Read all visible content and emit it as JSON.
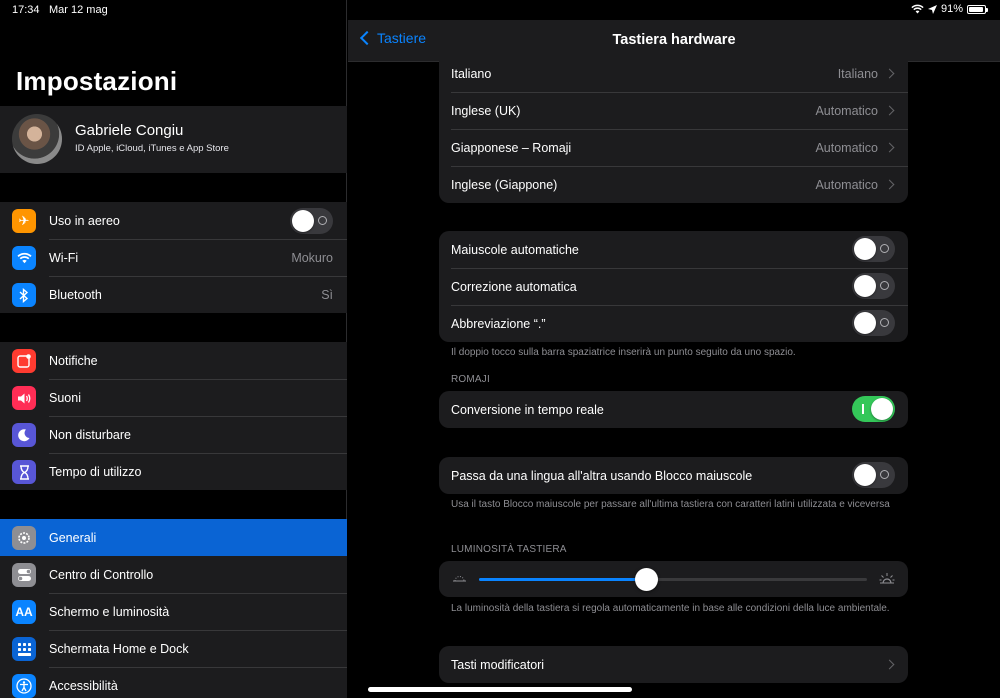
{
  "status": {
    "time": "17:34",
    "date": "Mar 12 mag",
    "battery": "91%",
    "battery_level": 0.91
  },
  "sidebar": {
    "title": "Impostazioni",
    "profile": {
      "name": "Gabriele Congiu",
      "subtitle": "ID Apple, iCloud, iTunes e App Store"
    },
    "groups": [
      [
        {
          "label": "Uso in aereo",
          "icon": "airplane-icon",
          "color": "#ff9500",
          "toggle": false
        },
        {
          "label": "Wi-Fi",
          "icon": "wifi-icon",
          "color": "#0a84ff",
          "value": "Mokuro"
        },
        {
          "label": "Bluetooth",
          "icon": "bluetooth-icon",
          "color": "#0a84ff",
          "value": "Sì"
        }
      ],
      [
        {
          "label": "Notifiche",
          "icon": "notifications-icon",
          "color": "#ff3b30"
        },
        {
          "label": "Suoni",
          "icon": "speaker-icon",
          "color": "#ff2d55"
        },
        {
          "label": "Non disturbare",
          "icon": "moon-icon",
          "color": "#5856d6"
        },
        {
          "label": "Tempo di utilizzo",
          "icon": "hourglass-icon",
          "color": "#5856d6"
        }
      ],
      [
        {
          "label": "Generali",
          "icon": "gear-icon",
          "color": "#8e8e93",
          "selected": true
        },
        {
          "label": "Centro di Controllo",
          "icon": "switches-icon",
          "color": "#8e8e93"
        },
        {
          "label": "Schermo e luminosità",
          "icon": "text-size-icon",
          "color": "#0a84ff"
        },
        {
          "label": "Schermata Home e Dock",
          "icon": "grid-icon",
          "color": "#0a64d4"
        },
        {
          "label": "Accessibilità",
          "icon": "accessibility-icon",
          "color": "#0a84ff"
        }
      ]
    ]
  },
  "navbar": {
    "back_label": "Tastiere",
    "title": "Tastiera hardware"
  },
  "keyboards": [
    {
      "label": "Italiano",
      "value": "Italiano"
    },
    {
      "label": "Inglese (UK)",
      "value": "Automatico"
    },
    {
      "label": "Giapponese – Romaji",
      "value": "Automatico"
    },
    {
      "label": "Inglese (Giappone)",
      "value": "Automatico"
    }
  ],
  "options": [
    {
      "label": "Maiuscole automatiche",
      "on": false
    },
    {
      "label": "Correzione automatica",
      "on": false
    },
    {
      "label": "Abbreviazione “.”",
      "on": false
    }
  ],
  "options_footer": "Il doppio tocco sulla barra spaziatrice inserirà un punto seguito da uno spazio.",
  "romaji": {
    "header": "ROMAJI",
    "label": "Conversione in tempo reale",
    "on": true
  },
  "caps_switch": {
    "label": "Passa da una lingua all'altra usando Blocco maiuscole",
    "on": false,
    "footer": "Usa il tasto Blocco maiuscole per passare all'ultima tastiera con caratteri latini utilizzata e viceversa"
  },
  "brightness": {
    "header": "LUMINOSITÀ TASTIERA",
    "level": 0.43,
    "footer": "La luminosità della tastiera si regola automaticamente in base alle condizioni della luce ambientale."
  },
  "modifiers": {
    "label": "Tasti modificatori"
  }
}
